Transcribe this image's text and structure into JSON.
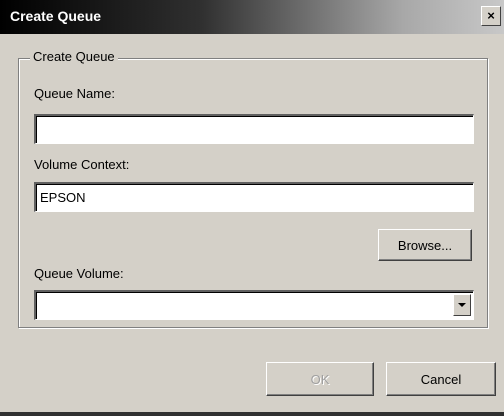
{
  "window": {
    "title": "Create Queue",
    "close_label": "×"
  },
  "group": {
    "title": "Create Queue"
  },
  "fields": {
    "queue_name": {
      "label": "Queue Name:",
      "value": ""
    },
    "volume_context": {
      "label": "Volume Context:",
      "value": "EPSON"
    },
    "queue_volume": {
      "label": "Queue Volume:",
      "selected": ""
    }
  },
  "buttons": {
    "browse": "Browse...",
    "ok": "OK",
    "cancel": "Cancel"
  },
  "icons": {
    "close": "close-icon",
    "dropdown": "chevron-down-icon"
  },
  "colors": {
    "dialog_bg": "#d4d0c8",
    "titlebar_start": "#000000",
    "titlebar_end": "#c8c8c8"
  }
}
